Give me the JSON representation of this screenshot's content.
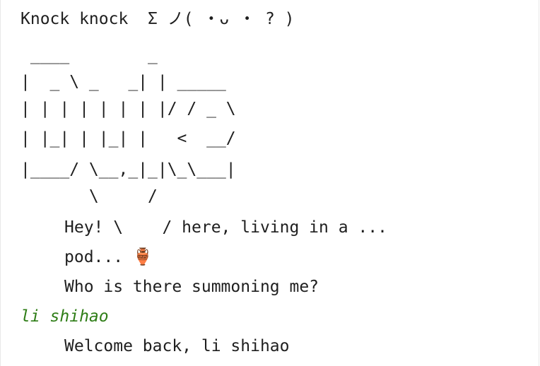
{
  "terminal": {
    "header_line": "Knock knock  Σ ノ( ・ᴗ ・ ? )",
    "ascii_art": [
      " ____        _",
      "|  _ \\ _   _| | _____",
      "| | | | | | | |/ / _ \\",
      "| |_| | |_| |   <  __/",
      "|____/ \\__,_|_|\\_\\___|",
      "       \\     /"
    ],
    "greeting_line_1": "Hey! \\    / here, living in a ...",
    "greeting_line_2": "pod... 🏺",
    "prompt_question": "Who is there summoning me?",
    "user_input": "li shihao",
    "welcome_message": "Welcome back, li shihao"
  },
  "colors": {
    "text": "#1e1e1e",
    "user_input": "#2e7d16",
    "background": "#ffffff"
  }
}
